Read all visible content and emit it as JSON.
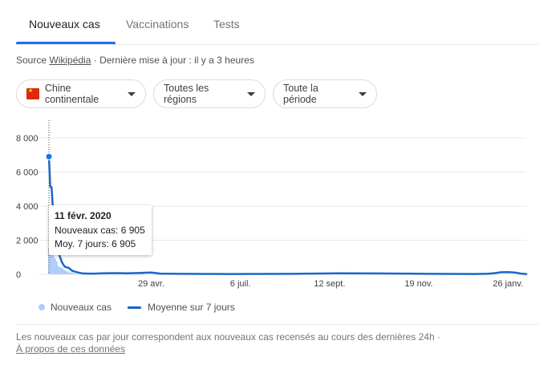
{
  "tabs": [
    {
      "label": "Nouveaux cas"
    },
    {
      "label": "Vaccinations"
    },
    {
      "label": "Tests"
    }
  ],
  "source": {
    "prefix": "Source",
    "link": "Wikipédia",
    "updated": "· Dernière mise à jour : il y a 3 heures"
  },
  "filters": {
    "region": "Chine continentale",
    "subregion": "Toutes les régions",
    "period": "Toute la période"
  },
  "colors": {
    "line": "#1a66c9",
    "bars": "#aecbfa",
    "accent": "#1a73e8",
    "flag": "#de2910"
  },
  "tooltip": {
    "date": "11 févr. 2020",
    "new_cases": "Nouveaux cas: 6 905",
    "avg": "Moy. 7 jours: 6 905"
  },
  "legend": {
    "bars": "Nouveaux cas",
    "line": "Moyenne sur 7 jours"
  },
  "footer": {
    "note": "Les nouveaux cas par jour correspondent aux nouveaux cas recensés au cours des dernières 24h  ·",
    "link": "À propos de ces données"
  },
  "chart_data": {
    "type": "line",
    "title": "",
    "xlabel": "",
    "ylabel": "",
    "ylim": [
      0,
      8000
    ],
    "y_ticks": [
      0,
      2000,
      4000,
      6000,
      8000
    ],
    "y_tick_labels": [
      "0",
      "2 000",
      "4 000",
      "6 000",
      "8 000"
    ],
    "x_tick_labels": [
      "29 avr.",
      "6 juil.",
      "12 sept.",
      "19 nov.",
      "26 janv."
    ],
    "x_tick_days": [
      78,
      146,
      214,
      282,
      350
    ],
    "x_day_range": [
      0,
      364
    ],
    "grid": true,
    "legend_position": "bottom-left",
    "highlight": {
      "date": "11 févr. 2020",
      "day": 0,
      "value": 6905
    },
    "series": [
      {
        "name": "Moyenne sur 7 jours",
        "style": "line",
        "days": [
          0,
          1,
          2,
          3,
          4,
          5,
          6,
          8,
          10,
          12,
          15,
          18,
          21,
          25,
          30,
          35,
          40,
          50,
          60,
          70,
          75,
          78,
          85,
          100,
          120,
          140,
          160,
          185,
          200,
          220,
          250,
          270,
          290,
          310,
          325,
          335,
          340,
          345,
          350,
          355,
          360,
          364
        ],
        "values": [
          6905,
          5150,
          5100,
          3900,
          2900,
          2100,
          1600,
          1100,
          700,
          450,
          380,
          200,
          130,
          60,
          40,
          40,
          60,
          70,
          60,
          80,
          100,
          110,
          40,
          30,
          25,
          20,
          25,
          30,
          40,
          60,
          50,
          40,
          30,
          25,
          20,
          35,
          70,
          120,
          130,
          110,
          40,
          20
        ]
      },
      {
        "name": "Nouveaux cas",
        "style": "bar",
        "days": [
          0,
          1,
          2,
          3,
          4,
          5,
          6,
          7,
          8,
          9,
          10,
          11,
          12,
          13,
          14,
          15,
          16,
          17,
          18,
          19,
          20,
          21,
          22,
          24,
          26,
          28,
          30,
          40,
          55,
          68,
          70,
          72
        ],
        "values": [
          1500,
          1700,
          1800,
          1450,
          1000,
          900,
          750,
          500,
          430,
          410,
          380,
          320,
          250,
          200,
          160,
          130,
          110,
          100,
          80,
          60,
          50,
          40,
          30,
          20,
          20,
          15,
          20,
          40,
          60,
          80,
          130,
          60
        ]
      }
    ]
  }
}
